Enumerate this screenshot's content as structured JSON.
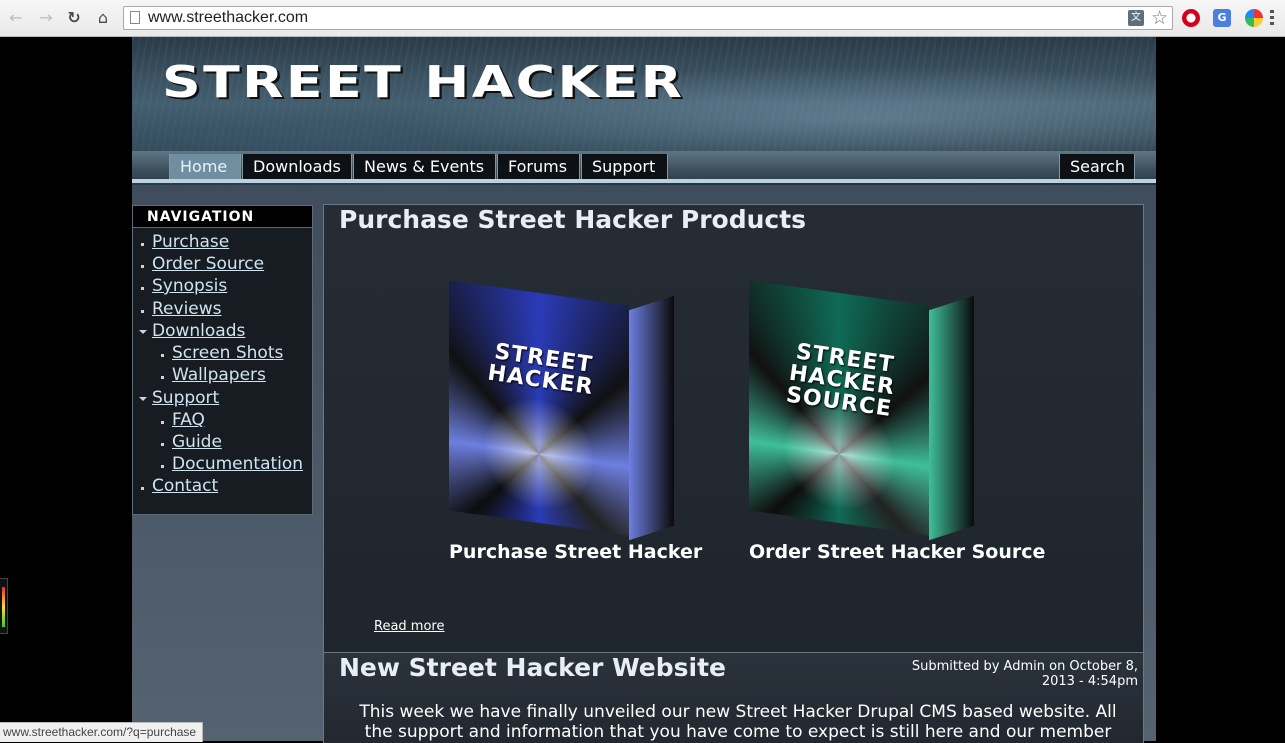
{
  "browser": {
    "url": "www.streethacker.com",
    "status_url": "www.streethacker.com/?q=purchase"
  },
  "site": {
    "logo": "STREET HACKER",
    "menu": {
      "home": "Home",
      "downloads": "Downloads",
      "news": "News & Events",
      "forums": "Forums",
      "support": "Support",
      "search": "Search"
    },
    "active_menu": "Home"
  },
  "sidebar": {
    "title": "NAVIGATION",
    "items": [
      {
        "label": "Purchase",
        "level": 1
      },
      {
        "label": "Order Source",
        "level": 1
      },
      {
        "label": "Synopsis",
        "level": 1
      },
      {
        "label": "Reviews",
        "level": 1
      },
      {
        "label": "Downloads",
        "level": 1,
        "expanded": true
      },
      {
        "label": "Screen Shots",
        "level": 2
      },
      {
        "label": "Wallpapers",
        "level": 2
      },
      {
        "label": "Support",
        "level": 1,
        "expanded": true
      },
      {
        "label": "FAQ",
        "level": 2
      },
      {
        "label": "Guide",
        "level": 2
      },
      {
        "label": "Documentation",
        "level": 2
      },
      {
        "label": "Contact",
        "level": 1
      }
    ]
  },
  "main": {
    "purchase_block": {
      "title": "Purchase Street Hacker Products",
      "box_hacker_text": "STREET HACKER",
      "box_source_text": "STREET HACKER SOURCE",
      "purchase_link": "Purchase Street Hacker",
      "order_link": "Order Street Hacker Source",
      "read_more": "Read more"
    },
    "news_block": {
      "title": "New Street Hacker Website",
      "submitted": "Submitted by Admin on October 8, 2013 - 4:54pm",
      "body": "This week we have finally unveiled our new Street Hacker Drupal CMS based website. All the support and information that you have come to expect is still here and our member"
    }
  },
  "colors": {
    "link": "#cfe3f0",
    "active_menu": "#6f8e9f",
    "menu_bg": "#0d1116"
  }
}
